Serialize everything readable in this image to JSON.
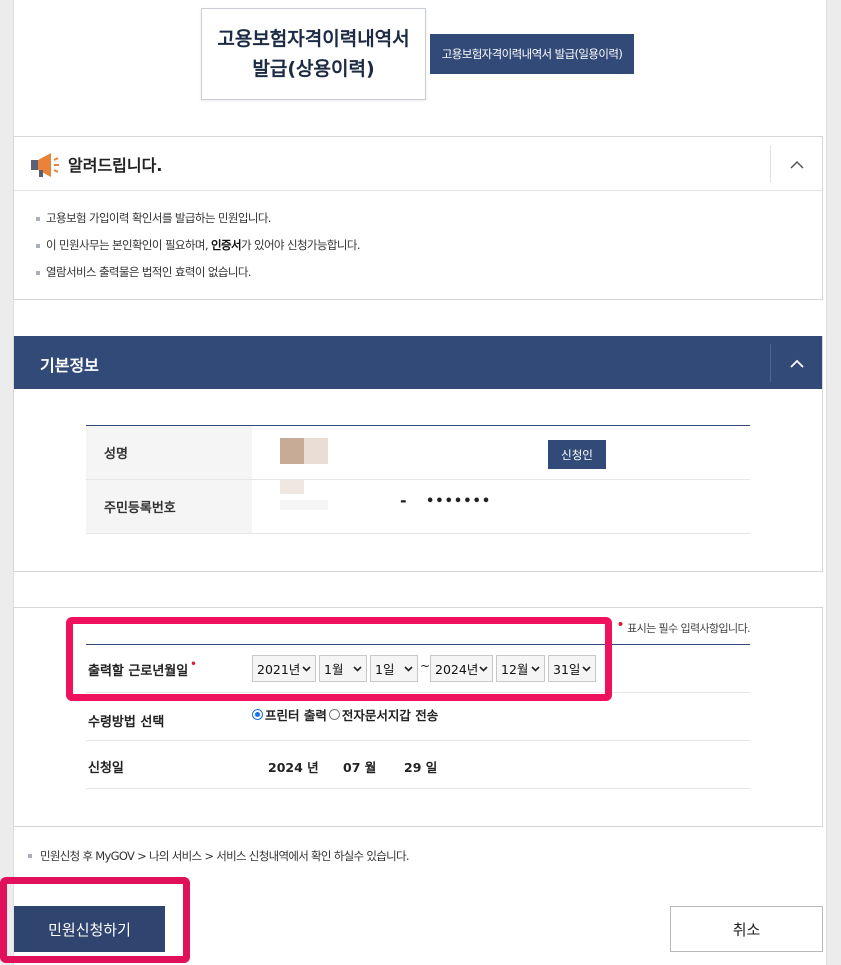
{
  "tabs": [
    {
      "label": "고용보험자격이력내역서 발급(상용이력)",
      "active": true
    },
    {
      "label": "고용보험자격이력내역서 발급(일용이력)",
      "active": false
    }
  ],
  "notice": {
    "title": "알려드립니다.",
    "items": [
      {
        "text": "고용보험 가입이력 확인서를 발급하는 민원입니다."
      },
      {
        "pre": "이 민원사무는 본인확인이 필요하며, ",
        "bold": "인증서",
        "post": "가 있어야 신청가능합니다."
      },
      {
        "text": "열람서비스 출력물은 법적인 효력이 없습니다."
      }
    ]
  },
  "basic_info": {
    "title": "기본정보",
    "name_label": "성명",
    "applicant_badge": "신청인",
    "rrn_label": "주민등록번호",
    "rrn_dash": "-",
    "rrn_mask": "•••••••"
  },
  "form": {
    "required_note": "표시는 필수 입력사항입니다.",
    "required_dot": "•",
    "period_label": "출력할 근로년월일",
    "period": {
      "from_year": "2021년",
      "from_month": "1월",
      "from_day": "1일",
      "tilde": "~",
      "to_year": "2024년",
      "to_month": "12월",
      "to_day": "31일"
    },
    "receive_label": "수령방법 선택",
    "receive_options": [
      {
        "label": "프린터 출력",
        "selected": true
      },
      {
        "label": "전자문서지갑 전송",
        "selected": false
      }
    ],
    "apply_date_label": "신청일",
    "apply_date": {
      "year": "2024 년",
      "month": "07 월",
      "day": "29 일"
    }
  },
  "bottom_note": "민원신청 후 MyGOV > 나의 서비스 > 서비스 신청내역에서 확인 하실수 있습니다.",
  "buttons": {
    "submit": "민원신청하기",
    "cancel": "취소"
  },
  "colors": {
    "primary": "#324a78",
    "highlight": "#f0115e",
    "required": "#e0192e"
  },
  "icons": {
    "notice": "megaphone-icon",
    "collapse": "chevron-up-icon",
    "select": "chevron-down-icon"
  }
}
